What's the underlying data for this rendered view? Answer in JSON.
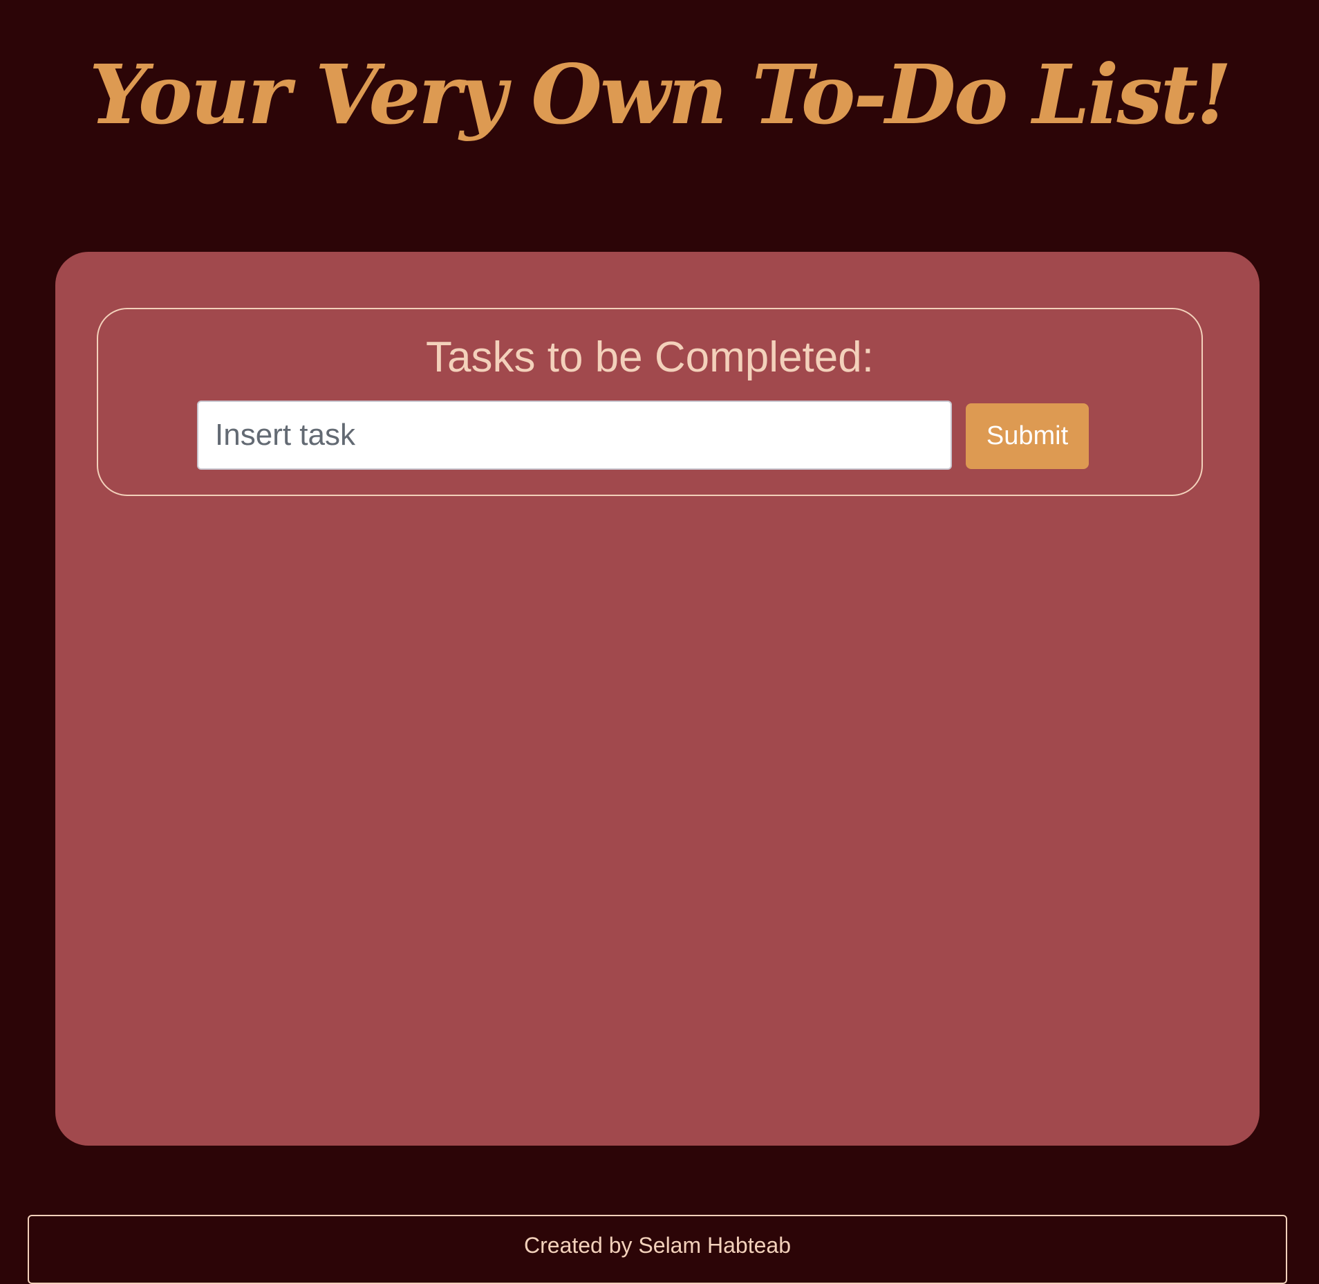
{
  "header": {
    "title": "Your Very Own To-Do List!"
  },
  "task_form": {
    "heading": "Tasks to be Completed:",
    "input_placeholder": "Insert task",
    "input_value": "",
    "submit_label": "Submit"
  },
  "footer": {
    "credit": "Created by Selam Habteab"
  },
  "colors": {
    "page_background": "#2c0507",
    "card_background": "#a1494d",
    "accent": "#dd9a52",
    "light_text": "#f3d1bb"
  }
}
